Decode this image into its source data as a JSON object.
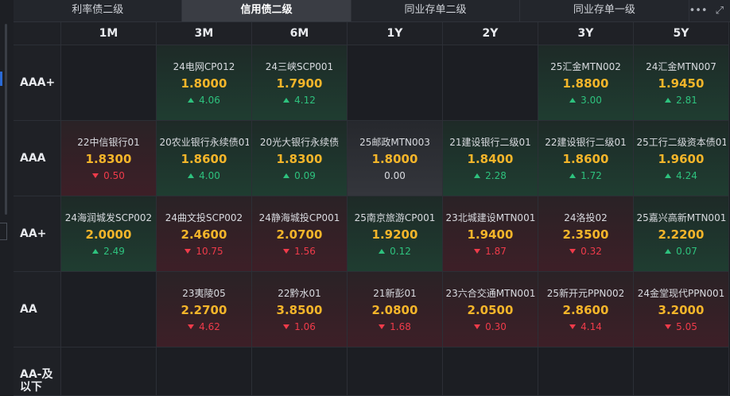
{
  "tabs": [
    "利率债二级",
    "信用债二级",
    "同业存单二级",
    "同业存单一级"
  ],
  "active_tab": 1,
  "tools": {
    "more": "•••",
    "expand": "⤢"
  },
  "columns": [
    "1M",
    "3M",
    "6M",
    "1Y",
    "2Y",
    "3Y",
    "5Y"
  ],
  "rows": [
    {
      "label": "AAA+",
      "cells": [
        null,
        {
          "name": "24电网CP012",
          "rate": "1.8000",
          "chg": "4.06",
          "dir": "up"
        },
        {
          "name": "24三峡SCP001",
          "rate": "1.7900",
          "chg": "4.12",
          "dir": "up"
        },
        null,
        null,
        {
          "name": "25汇金MTN002",
          "rate": "1.8800",
          "chg": "3.00",
          "dir": "up"
        },
        {
          "name": "24汇金MTN007",
          "rate": "1.9450",
          "chg": "2.81",
          "dir": "up"
        }
      ]
    },
    {
      "label": "AAA",
      "cells": [
        {
          "name": "22中信银行01",
          "rate": "1.8300",
          "chg": "0.50",
          "dir": "down"
        },
        {
          "name": "20农业银行永续债01",
          "rate": "1.8600",
          "chg": "4.00",
          "dir": "up"
        },
        {
          "name": "20光大银行永续债",
          "rate": "1.8300",
          "chg": "0.09",
          "dir": "up"
        },
        {
          "name": "25邮政MTN003",
          "rate": "1.8000",
          "chg": "0.00",
          "dir": "flat"
        },
        {
          "name": "21建设银行二级01",
          "rate": "1.8400",
          "chg": "2.28",
          "dir": "up"
        },
        {
          "name": "22建设银行二级01",
          "rate": "1.8600",
          "chg": "1.72",
          "dir": "up"
        },
        {
          "name": "25工行二级资本债01",
          "rate": "1.9600",
          "chg": "4.24",
          "dir": "up"
        }
      ]
    },
    {
      "label": "AA+",
      "cells": [
        {
          "name": "24海润城发SCP002",
          "rate": "2.0000",
          "chg": "2.49",
          "dir": "up"
        },
        {
          "name": "24曲文投SCP002",
          "rate": "2.4600",
          "chg": "10.75",
          "dir": "down"
        },
        {
          "name": "24静海城投CP001",
          "rate": "2.0700",
          "chg": "1.56",
          "dir": "down"
        },
        {
          "name": "25南京旅游CP001",
          "rate": "1.9200",
          "chg": "0.12",
          "dir": "up"
        },
        {
          "name": "23北城建设MTN001",
          "rate": "1.9400",
          "chg": "1.87",
          "dir": "down"
        },
        {
          "name": "24洛投02",
          "rate": "2.3500",
          "chg": "0.32",
          "dir": "down"
        },
        {
          "name": "25嘉兴高新MTN001",
          "rate": "2.2200",
          "chg": "0.07",
          "dir": "up"
        }
      ]
    },
    {
      "label": "AA",
      "cells": [
        null,
        {
          "name": "23夷陵05",
          "rate": "2.2700",
          "chg": "4.62",
          "dir": "down"
        },
        {
          "name": "22黔水01",
          "rate": "3.8500",
          "chg": "1.06",
          "dir": "down"
        },
        {
          "name": "21新彭01",
          "rate": "2.0800",
          "chg": "1.68",
          "dir": "down"
        },
        {
          "name": "23六合交通MTN001",
          "rate": "2.0500",
          "chg": "0.30",
          "dir": "down"
        },
        {
          "name": "25新开元PPN002",
          "rate": "2.8600",
          "chg": "4.14",
          "dir": "down"
        },
        {
          "name": "24金堂现代PPN001",
          "rate": "3.2000",
          "chg": "5.05",
          "dir": "down"
        }
      ]
    },
    {
      "label": "AA-及以下",
      "cells": [
        null,
        null,
        null,
        null,
        null,
        null,
        null
      ]
    }
  ],
  "colors": {
    "up": "#2ec27e",
    "down": "#ef3b4a",
    "rate": "#f4b52a"
  }
}
